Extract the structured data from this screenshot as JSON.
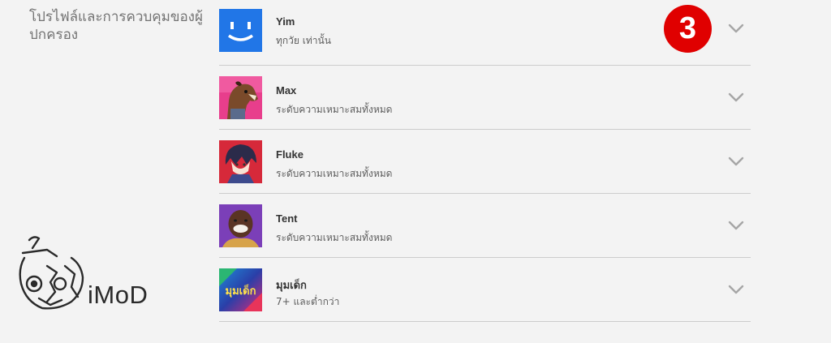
{
  "section": {
    "title": "โปรไฟล์และการควบคุมของผู้ปกครอง"
  },
  "profiles": [
    {
      "name": "Yim",
      "rating": "ทุกวัย เท่านั้น",
      "avatar_icon": "smiley-avatar-icon"
    },
    {
      "name": "Max",
      "rating": "ระดับความเหมาะสมทั้งหมด",
      "avatar_icon": "horse-cartoon-avatar-icon"
    },
    {
      "name": "Fluke",
      "rating": "ระดับความเหมาะสมทั้งหมด",
      "avatar_icon": "anime-character-avatar-icon"
    },
    {
      "name": "Tent",
      "rating": "ระดับความเหมาะสมทั้งหมด",
      "avatar_icon": "man-portrait-avatar-icon"
    },
    {
      "name": "มุมเด็ก",
      "rating": "7+ และต่ำกว่า",
      "avatar_icon": "kids-avatar-icon",
      "avatar_text": "มุมเด็ก"
    }
  ],
  "step_badge": {
    "number": "3",
    "color": "#e00000"
  },
  "watermark": {
    "text": "iMoD"
  },
  "colors": {
    "background": "#f3f3f3",
    "divider": "#cccccc",
    "chevron": "#a6a6a6"
  }
}
